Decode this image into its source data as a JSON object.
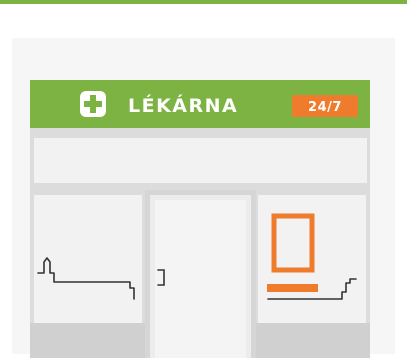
{
  "sign": {
    "name": "LÉKÁRNA",
    "hours_badge": "24/7",
    "icon": "medical-cross-icon"
  },
  "colors": {
    "accent_green": "#7cb342",
    "badge_orange": "#ef7b2d",
    "frame_gray": "#d9d9d9",
    "glass": "#f2f2f2"
  }
}
